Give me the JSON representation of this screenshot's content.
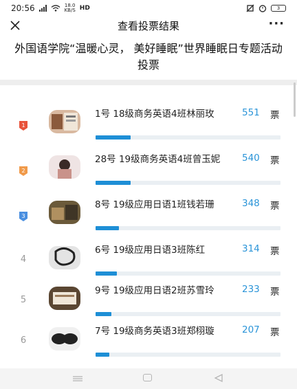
{
  "status_bar": {
    "time": "20:56",
    "network_speed": "18.0\nKB/S",
    "network_type": "HD",
    "battery": "3"
  },
  "nav": {
    "title": "查看投票结果",
    "close_icon": "close-icon",
    "more_label": "···"
  },
  "heading": "外国语学院“温暖心灵， 美好睡眠”世界睡眠日专题活动投票",
  "votes_unit": "票",
  "entries": [
    {
      "rank": "1",
      "name": "1号 18级商务英语4班林丽玫",
      "votes": "551",
      "votes_value": 551,
      "medal": "gold"
    },
    {
      "rank": "2",
      "name": "28号 19级商务英语4班曾玉妮",
      "votes": "540",
      "votes_value": 540,
      "medal": "silver"
    },
    {
      "rank": "3",
      "name": "8号 19级应用日语1班钱若珊",
      "votes": "348",
      "votes_value": 348,
      "medal": "bronze"
    },
    {
      "rank": "4",
      "name": "6号 19级应用日语3班陈红",
      "votes": "314",
      "votes_value": 314,
      "medal": ""
    },
    {
      "rank": "5",
      "name": "9号 19级应用日语2班苏雪玲",
      "votes": "233",
      "votes_value": 233,
      "medal": ""
    },
    {
      "rank": "6",
      "name": "7号 19级商务英语3班郑栩璇",
      "votes": "207",
      "votes_value": 207,
      "medal": ""
    }
  ],
  "bar_fill_fractions": [
    0.19,
    0.19,
    0.125,
    0.115,
    0.085,
    0.075
  ],
  "colors": {
    "accent": "#1e8fd6",
    "vote_text": "#2a94d8",
    "medal_gold": "#e8523a",
    "medal_silver": "#f09a4a",
    "medal_bronze": "#4a8fe0"
  }
}
